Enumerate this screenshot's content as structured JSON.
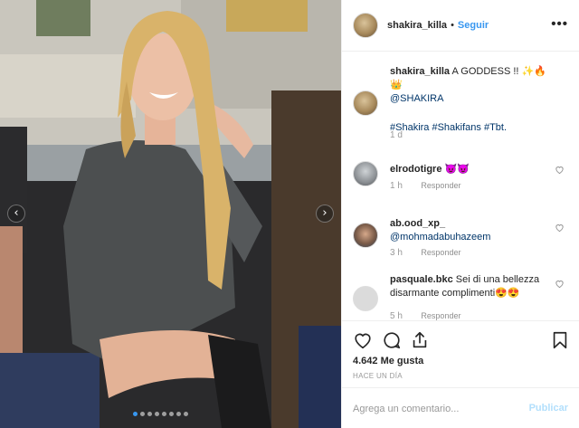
{
  "post": {
    "username": "shakira_killa",
    "follow_label": "Seguir",
    "bullet": "•",
    "more_icon": "more-horizontal-icon"
  },
  "caption": {
    "username": "shakira_killa",
    "text": "A GODDESS !! ✨🔥👑",
    "mention": "@SHAKIRA",
    "tags": "#Shakira #Shakifans #Tbt.",
    "time": "1 d"
  },
  "comments": [
    {
      "username": "elrodotigre",
      "text": "😈😈",
      "time": "1 h",
      "reply": "Responder"
    },
    {
      "username": "ab.ood_xp_",
      "text": "@mohmadabuhazeem",
      "time": "3 h",
      "reply": "Responder"
    },
    {
      "username": "pasquale.bkc",
      "text": "Sei di una bellezza disarmante complimenti😍😍",
      "time": "5 h",
      "reply": "Responder"
    }
  ],
  "actions": {
    "likes": "4.642 Me gusta",
    "ago": "HACE UN DÍA",
    "comment_placeholder": "Agrega un comentario...",
    "publish_label": "Publicar"
  },
  "carousel": {
    "prev_glyph": "‹",
    "next_glyph": "›",
    "dot_count": 8,
    "active_dot": 0
  },
  "colors": {
    "accent": "#3897f0",
    "publish_disabled": "#b2dffc",
    "text": "#262626",
    "muted": "#8e8e8e"
  }
}
